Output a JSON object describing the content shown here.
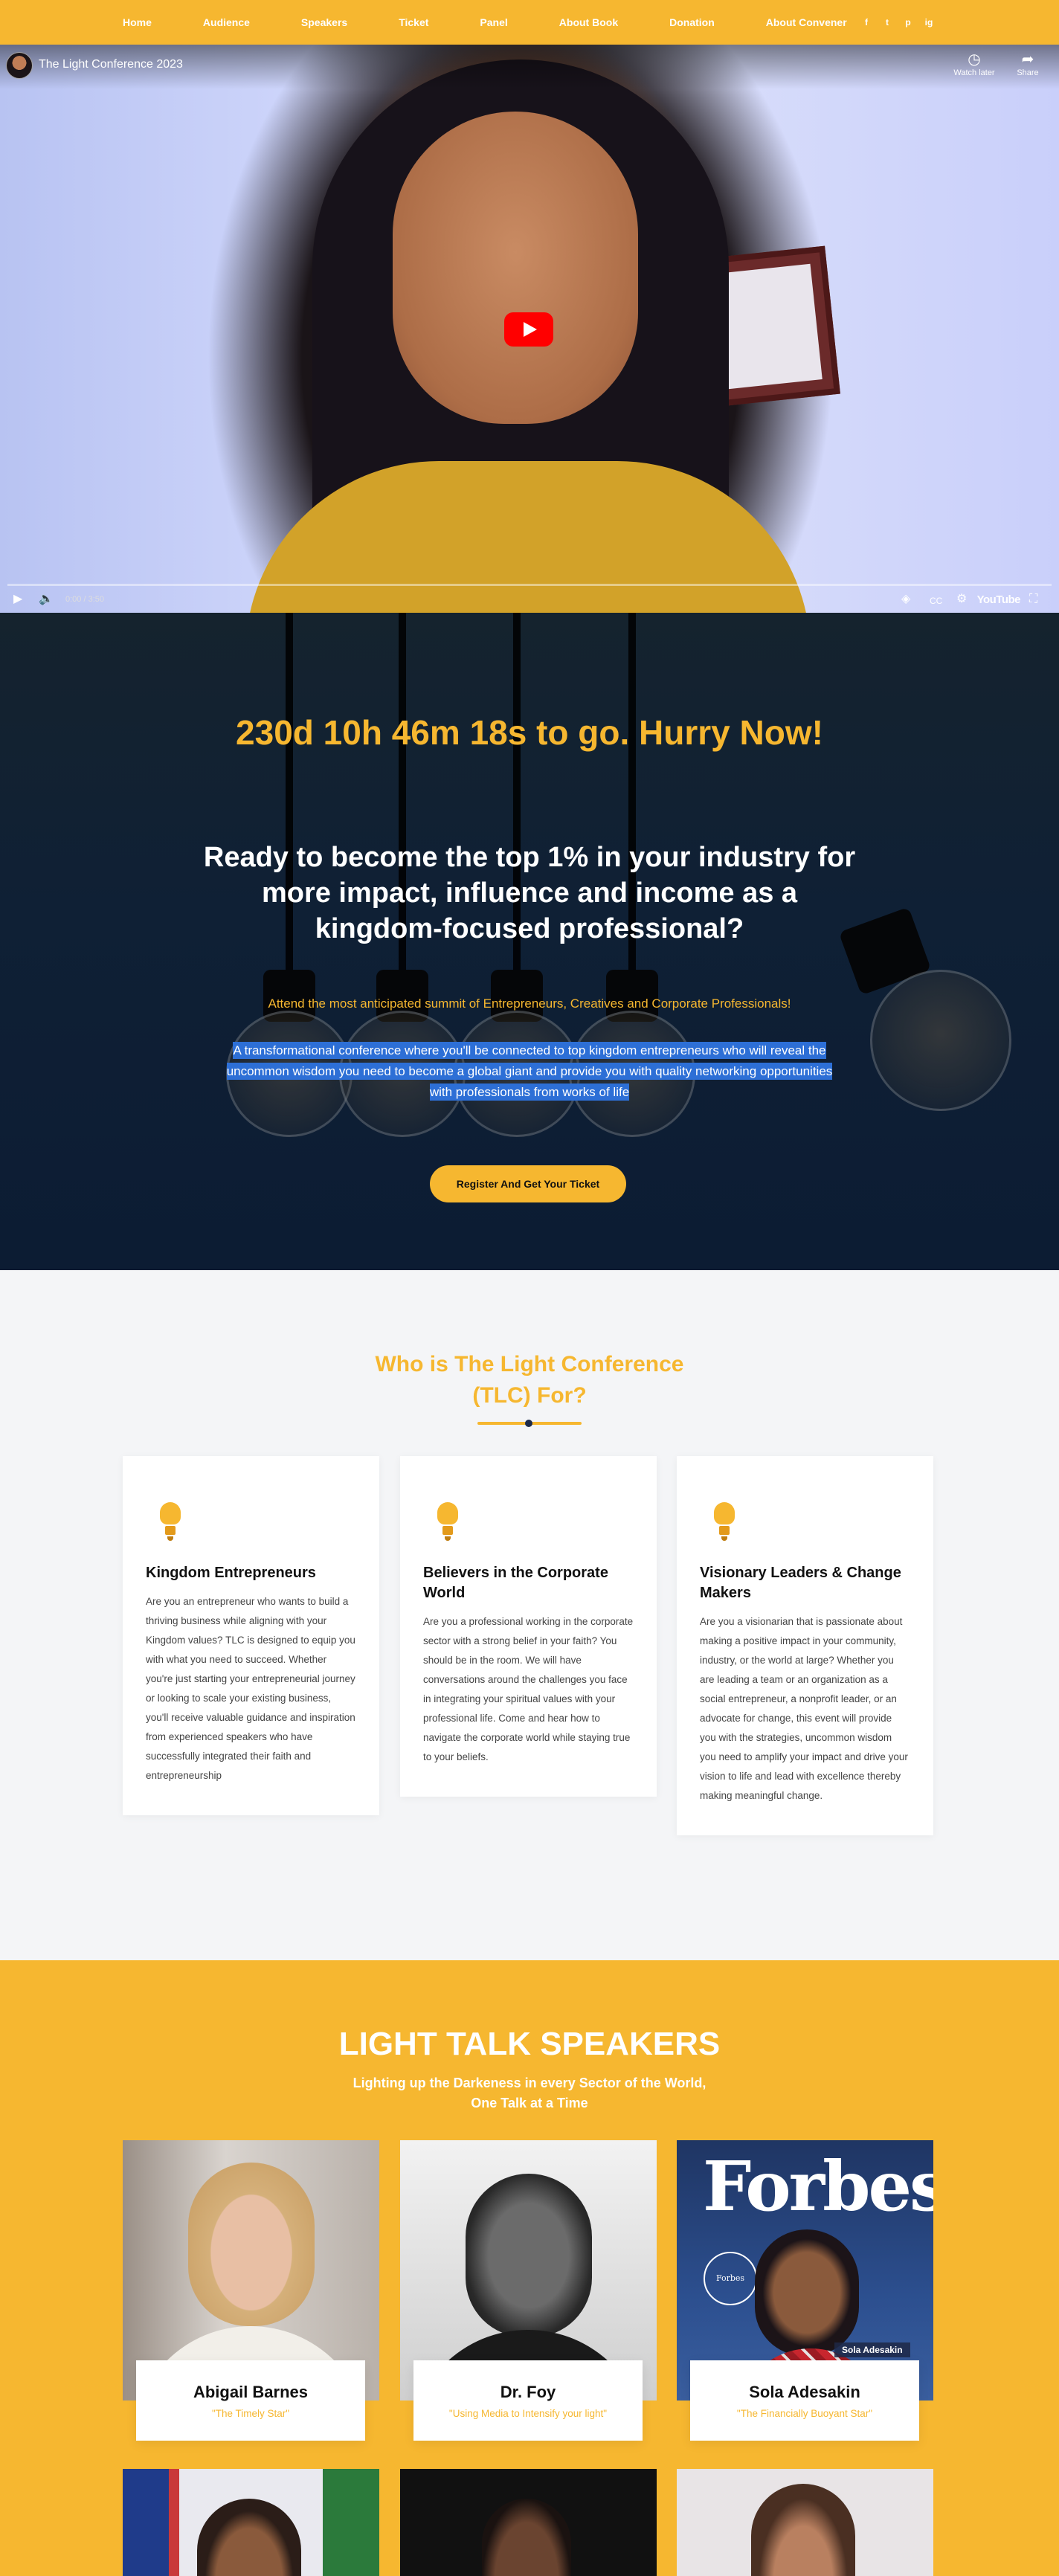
{
  "nav": {
    "links": [
      "Home",
      "Audience",
      "Speakers",
      "Ticket",
      "Panel",
      "About Book",
      "Donation",
      "About Convener"
    ],
    "social": [
      "f",
      "t",
      "p",
      "ig"
    ]
  },
  "video": {
    "title": "The Light Conference 2023",
    "watch_later": "Watch later",
    "share": "Share",
    "time": "0:00 / 3:50",
    "logo": "YouTube"
  },
  "hero": {
    "countdown": "230d 10h 46m 18s to go. Hurry Now!",
    "headline": "Ready to become the top 1% in your industry for more impact, influence and income as a kingdom-focused professional?",
    "subheadline": "Attend the most anticipated summit of Entrepreneurs, Creatives and Corporate Professionals!",
    "description": "A transformational conference where you'll be connected to top kingdom entrepreneurs who will reveal the uncommon wisdom you need to become a global giant and provide you with quality networking opportunities with professionals from works of life",
    "cta": "Register And Get Your Ticket"
  },
  "who": {
    "title": "Who is The Light Conference (TLC) For?",
    "cards": [
      {
        "title": "Kingdom Entrepreneurs",
        "text": "Are you an entrepreneur who wants to build a thriving business while aligning with your Kingdom values? TLC is designed to equip you with what you need to succeed. Whether you're just starting your entrepreneurial journey or looking to scale your existing business, you'll receive valuable guidance and inspiration from experienced speakers who have successfully integrated their faith and entrepreneurship"
      },
      {
        "title": "Believers in the Corporate World",
        "text": "Are you a professional working in the corporate sector with a strong belief in your faith? You should be in the room. We will have conversations around the challenges you face in integrating your spiritual values with your professional life. Come and hear how to navigate the corporate world while staying true to your beliefs."
      },
      {
        "title": "Visionary Leaders & Change Makers",
        "text": "Are you a visionarian that is passionate about making a positive impact in your community, industry, or the world at large? Whether you are leading a team or an organization as a social entrepreneur, a nonprofit leader, or an advocate for change, this event will provide you with the strategies, uncommon wisdom you need to amplify your impact and drive your vision to life and lead with excellence thereby making meaningful change."
      }
    ]
  },
  "speakers": {
    "title": "LIGHT TALK SPEAKERS",
    "subtitle": "Lighting up the Darkeness in every Sector of the World, One Talk at a Time",
    "items": [
      {
        "name": "Abigail Barnes",
        "tagline": "\"The Timely Star\""
      },
      {
        "name": "Dr. Foy",
        "tagline": "\"Using Media to Intensify your light\""
      },
      {
        "name": "Sola Adesakin",
        "tagline": "\"The Financially Buoyant Star\""
      }
    ],
    "forbes": {
      "masthead": "Forbes",
      "badge": "Forbes",
      "label": "Sola Adesakin"
    }
  }
}
